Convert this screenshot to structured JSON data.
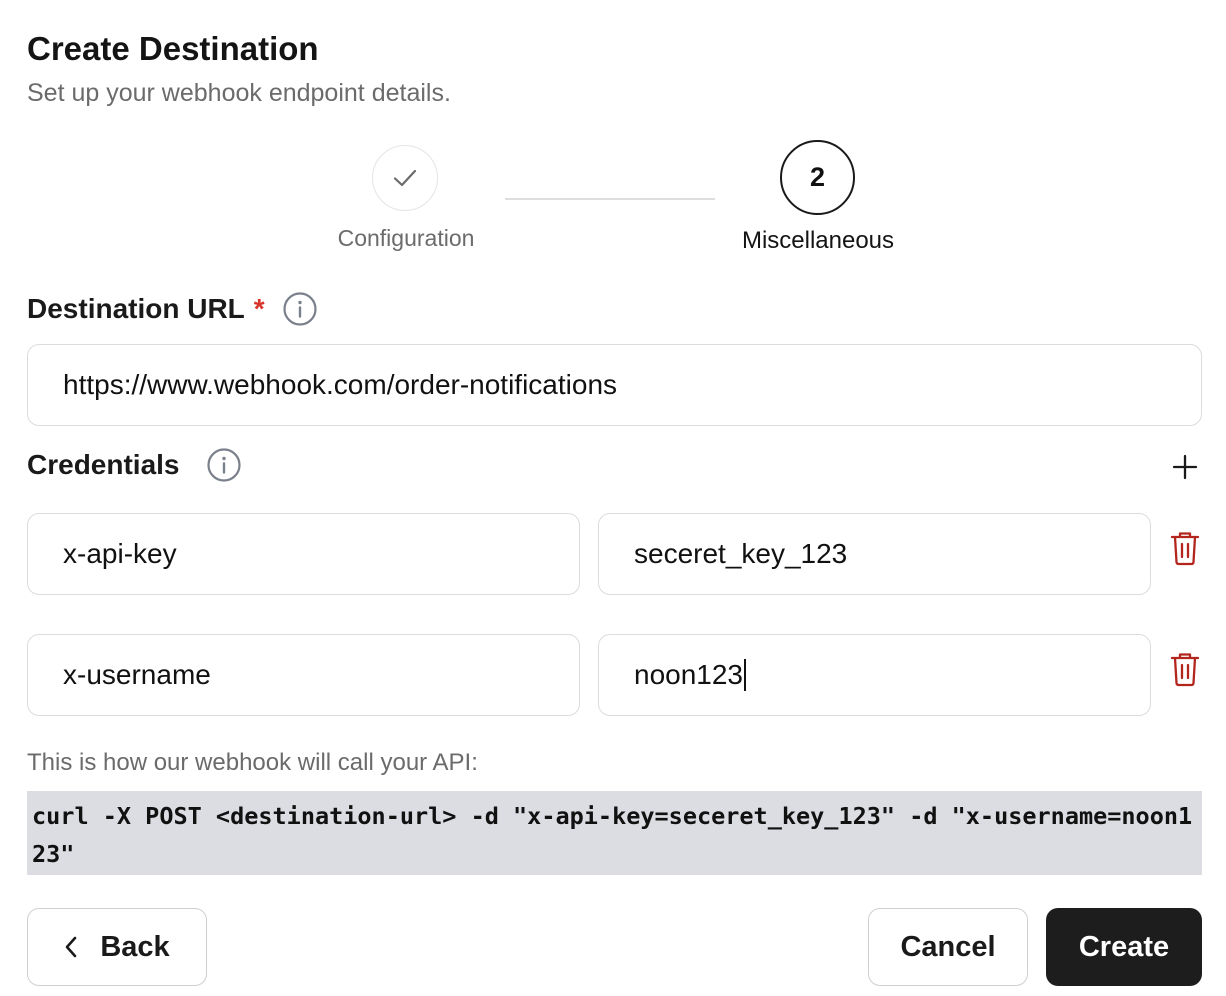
{
  "header": {
    "title": "Create Destination",
    "subtitle": "Set up your webhook endpoint details."
  },
  "stepper": {
    "steps": [
      {
        "label": "Configuration",
        "status": "completed",
        "icon": "check-icon"
      },
      {
        "label": "Miscellaneous",
        "status": "active",
        "number": "2"
      }
    ]
  },
  "destination_url": {
    "label": "Destination URL",
    "required_mark": "*",
    "value": "https://www.webhook.com/order-notifications"
  },
  "credentials": {
    "label": "Credentials",
    "add_icon": "plus-icon",
    "rows": [
      {
        "key": "x-api-key",
        "value": "seceret_key_123"
      },
      {
        "key": "x-username",
        "value": "noon123"
      }
    ],
    "delete_icon": "trash-icon"
  },
  "preview": {
    "help_text": "This is how our webhook will call your API:",
    "code": "curl -X POST <destination-url> -d \"x-api-key=seceret_key_123\" -d \"x-username=noon123\""
  },
  "footer": {
    "back_label": "Back",
    "cancel_label": "Cancel",
    "create_label": "Create"
  },
  "colors": {
    "accent_dark": "#1d1d1d",
    "required": "#d9342b",
    "danger_icon": "#b3261e",
    "code_bg": "#dcdde2"
  }
}
